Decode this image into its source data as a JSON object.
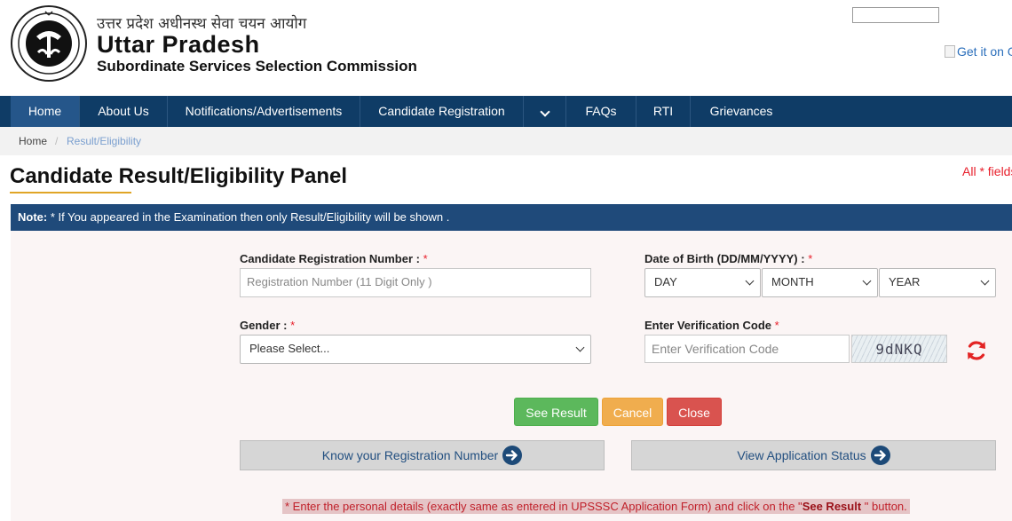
{
  "header": {
    "hindi_title": "उत्तर प्रदेश अधीनस्थ सेवा चयन आयोग",
    "title": "Uttar Pradesh",
    "subtitle": "Subordinate Services Selection Commission",
    "get_it_on": "Get it on G"
  },
  "nav": {
    "items": [
      {
        "label": "Home"
      },
      {
        "label": "About Us"
      },
      {
        "label": "Notifications/Advertisements"
      },
      {
        "label": "Candidate Registration"
      },
      {
        "label": "FAQs"
      },
      {
        "label": "RTI"
      },
      {
        "label": "Grievances"
      }
    ]
  },
  "breadcrumb": {
    "home": "Home",
    "separator": "/",
    "current": "Result/Eligibility"
  },
  "page": {
    "title": "Candidate Result/Eligibility Panel",
    "required_note": "All * fields"
  },
  "note": {
    "prefix": "Note:",
    "text": " * If You appeared in the Examination then only Result/Eligibility will be shown ."
  },
  "form": {
    "reg_label": "Candidate Registration Number :",
    "reg_placeholder": "Registration Number (11 Digit Only )",
    "dob_label": "Date of Birth (DD/MM/YYYY) :",
    "day": "DAY",
    "month": "MONTH",
    "year": "YEAR",
    "gender_label": "Gender :",
    "gender_value": "Please Select...",
    "captcha_label": "Enter Verification Code",
    "captcha_placeholder": "Enter Verification Code",
    "captcha_text": "9dNKQ",
    "star": "*"
  },
  "buttons": {
    "see_result": "See Result",
    "cancel": "Cancel",
    "close": "Close",
    "know_reg": "Know your Registration Number",
    "view_status": "View Application Status"
  },
  "bottom_note": {
    "part1": "* Enter the personal details (exactly same as entered in UPSSSC Application Form) and click on the \"",
    "bold": "See Result",
    "part2": " \" button."
  },
  "colors": {
    "nav": "#0f3c66",
    "note_bar": "#1f4a7a",
    "accent_underline": "#e0a526",
    "required": "#e8202c"
  }
}
